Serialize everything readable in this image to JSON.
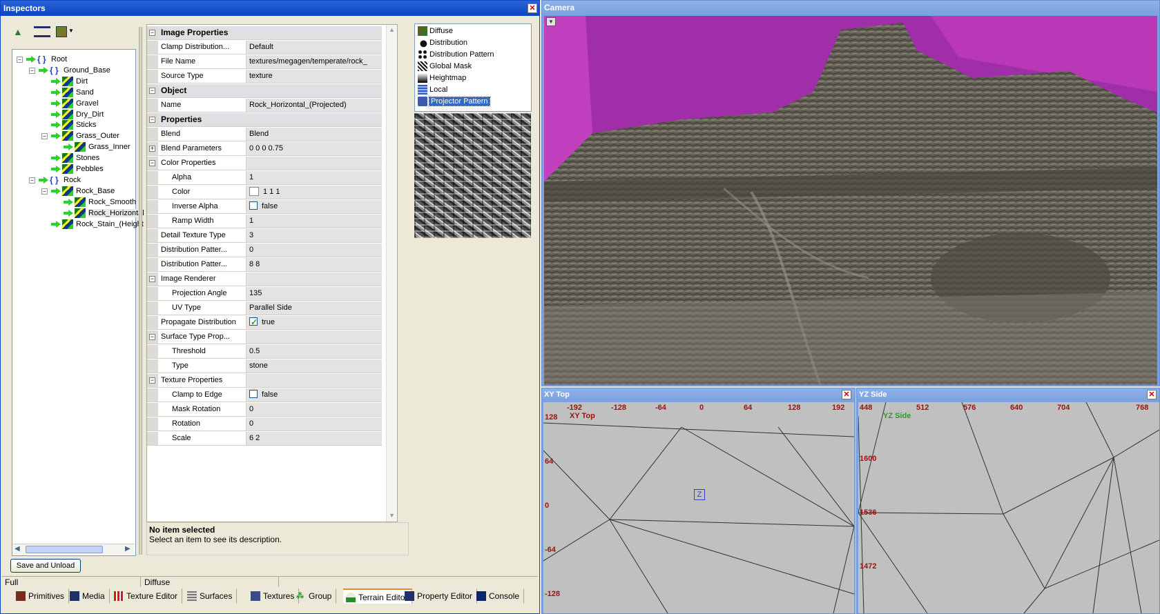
{
  "inspectors": {
    "title": "Inspectors",
    "save_button": "Save and Unload",
    "status_left": "Full",
    "status_right": "Diffuse"
  },
  "tree": {
    "items": [
      {
        "label": "Root",
        "kind": "group"
      },
      {
        "label": "Ground_Base",
        "kind": "group"
      },
      {
        "label": "Dirt",
        "kind": "texture"
      },
      {
        "label": "Sand",
        "kind": "texture"
      },
      {
        "label": "Gravel",
        "kind": "texture"
      },
      {
        "label": "Dry_Dirt",
        "kind": "texture"
      },
      {
        "label": "Sticks",
        "kind": "texture"
      },
      {
        "label": "Grass_Outer",
        "kind": "texture"
      },
      {
        "label": "Grass_Inner",
        "kind": "texture"
      },
      {
        "label": "Stones",
        "kind": "texture"
      },
      {
        "label": "Pebbles",
        "kind": "texture"
      },
      {
        "label": "Rock",
        "kind": "group"
      },
      {
        "label": "Rock_Base",
        "kind": "texture"
      },
      {
        "label": "Rock_Smooth",
        "kind": "texture"
      },
      {
        "label": "Rock_Horizontal",
        "kind": "texture"
      },
      {
        "label": "Rock_Stain_(Height",
        "kind": "texture"
      }
    ]
  },
  "properties": {
    "rows": [
      {
        "type": "cat",
        "key": "Image Properties"
      },
      {
        "type": "prop",
        "key": "Clamp Distribution...",
        "value": "Default"
      },
      {
        "type": "prop",
        "key": "File Name",
        "value": "textures/megagen/temperate/rock_"
      },
      {
        "type": "prop",
        "key": "Source Type",
        "value": "texture"
      },
      {
        "type": "cat",
        "key": "Object"
      },
      {
        "type": "prop",
        "key": "Name",
        "value": "Rock_Horizontal_(Projected)"
      },
      {
        "type": "cat",
        "key": "Properties"
      },
      {
        "type": "prop",
        "key": "Blend",
        "value": "Blend"
      },
      {
        "type": "expand",
        "key": "Blend Parameters",
        "value": "0 0 0 0.75"
      },
      {
        "type": "sub",
        "key": "Color Properties",
        "value": ""
      },
      {
        "type": "indent",
        "key": "Alpha",
        "value": "1"
      },
      {
        "type": "indent-color",
        "key": "Color",
        "value": "1 1 1"
      },
      {
        "type": "indent-check",
        "key": "Inverse Alpha",
        "value": "false",
        "checked": false
      },
      {
        "type": "indent",
        "key": "Ramp Width",
        "value": "1"
      },
      {
        "type": "prop",
        "key": "Detail Texture Type",
        "value": "3"
      },
      {
        "type": "prop",
        "key": "Distribution Patter...",
        "value": "0"
      },
      {
        "type": "prop",
        "key": "Distribution Patter...",
        "value": "8 8"
      },
      {
        "type": "sub",
        "key": "Image Renderer",
        "value": ""
      },
      {
        "type": "indent",
        "key": "Projection Angle",
        "value": "135"
      },
      {
        "type": "indent",
        "key": "UV Type",
        "value": "Parallel Side"
      },
      {
        "type": "check",
        "key": "Propagate Distribution",
        "value": "true",
        "checked": true
      },
      {
        "type": "sub",
        "key": "Surface Type Prop...",
        "value": ""
      },
      {
        "type": "indent",
        "key": "Threshold",
        "value": "0.5"
      },
      {
        "type": "indent",
        "key": "Type",
        "value": "stone"
      },
      {
        "type": "sub",
        "key": "Texture Properties",
        "value": ""
      },
      {
        "type": "indent-check",
        "key": "Clamp to Edge",
        "value": "false",
        "checked": false
      },
      {
        "type": "indent",
        "key": "Mask Rotation",
        "value": "0"
      },
      {
        "type": "indent",
        "key": "Rotation",
        "value": "0"
      },
      {
        "type": "indent",
        "key": "Scale",
        "value": "6 2"
      }
    ],
    "desc_title": "No item selected",
    "desc_text": "Select an item to see its description."
  },
  "layer_list": {
    "items": [
      {
        "label": "Diffuse",
        "icon": "diffuse-icon"
      },
      {
        "label": "Distribution",
        "icon": "distribution-icon"
      },
      {
        "label": "Distribution Pattern",
        "icon": "distribution-pattern-icon"
      },
      {
        "label": "Global Mask",
        "icon": "global-mask-icon"
      },
      {
        "label": "Heightmap",
        "icon": "heightmap-icon"
      },
      {
        "label": "Local",
        "icon": "local-icon"
      },
      {
        "label": "Projector Pattern",
        "icon": "projector-pattern-icon",
        "selected": true
      }
    ]
  },
  "tabs": [
    {
      "label": "Primitives"
    },
    {
      "label": "Media"
    },
    {
      "label": "Texture Editor"
    },
    {
      "label": "Surfaces"
    },
    {
      "label": "Textures"
    },
    {
      "label": "Group"
    },
    {
      "label": "Terrain Editor",
      "active": true
    },
    {
      "label": "Property Editor"
    },
    {
      "label": "Console"
    }
  ],
  "camera": {
    "title": "Camera"
  },
  "xy_top": {
    "title": "XY Top",
    "overlay": "XY Top",
    "x_ticks": [
      "-192",
      "-128",
      "-64",
      "0",
      "64",
      "128",
      "192"
    ],
    "y_ticks": [
      "128",
      "64",
      "0",
      "-64",
      "-128"
    ],
    "marker": "Z"
  },
  "yz_side": {
    "title": "YZ Side",
    "overlay": "YZ Side",
    "x_ticks": [
      "448",
      "512",
      "576",
      "640",
      "704",
      "768"
    ],
    "y_ticks": [
      "1600",
      "1536",
      "1472"
    ]
  },
  "colors": {
    "titlebar": "#0a46c4",
    "sky": "#b030b0",
    "viewport_bg": "#c0c0c0",
    "tick_label": "#a01010",
    "overlay_green": "#2a9a2a"
  }
}
